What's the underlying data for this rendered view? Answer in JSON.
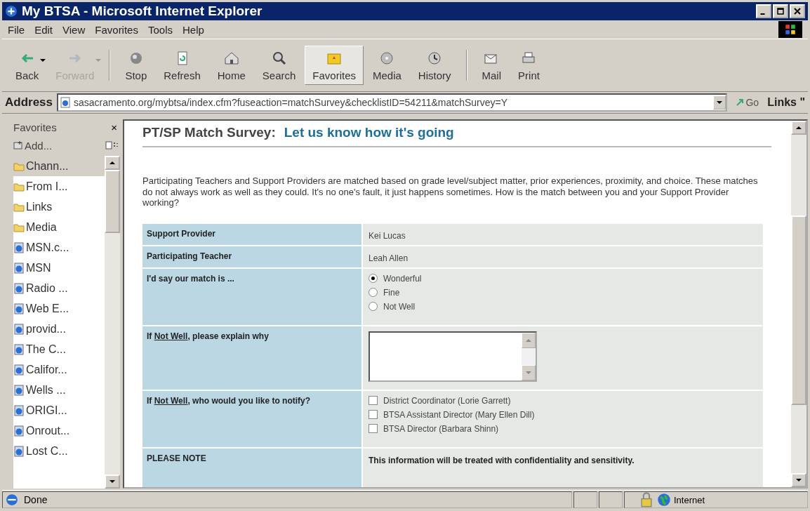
{
  "window": {
    "title": "My BTSA - Microsoft Internet Explorer"
  },
  "menu": [
    "File",
    "Edit",
    "View",
    "Favorites",
    "Tools",
    "Help"
  ],
  "toolbar": [
    {
      "label": "Back",
      "kind": "back",
      "disabled": false,
      "selected": false,
      "dropdown": true
    },
    {
      "label": "Forward",
      "kind": "forward",
      "disabled": true,
      "selected": false,
      "dropdown": true
    },
    {
      "label": "Stop",
      "kind": "stop",
      "disabled": false,
      "selected": false,
      "dropdown": false
    },
    {
      "label": "Refresh",
      "kind": "refresh",
      "disabled": false,
      "selected": false,
      "dropdown": false
    },
    {
      "label": "Home",
      "kind": "home",
      "disabled": false,
      "selected": false,
      "dropdown": false
    },
    {
      "label": "Search",
      "kind": "search",
      "disabled": false,
      "selected": false,
      "dropdown": false
    },
    {
      "label": "Favorites",
      "kind": "favorites",
      "disabled": false,
      "selected": true,
      "dropdown": false
    },
    {
      "label": "Media",
      "kind": "media",
      "disabled": false,
      "selected": false,
      "dropdown": false
    },
    {
      "label": "History",
      "kind": "history",
      "disabled": false,
      "selected": false,
      "dropdown": false
    },
    {
      "label": "Mail",
      "kind": "mail",
      "disabled": false,
      "selected": false,
      "dropdown": false
    },
    {
      "label": "Print",
      "kind": "print",
      "disabled": false,
      "selected": false,
      "dropdown": false
    }
  ],
  "address": {
    "label": "Address",
    "value": "sasacramento.org/mybtsa/index.cfm?fuseaction=matchSurvey&checklistID=54211&matchSurvey=Y",
    "go": "Go",
    "links": "Links \""
  },
  "favorites": {
    "title": "Favorites",
    "close": "×",
    "add": "Add...",
    "items": [
      {
        "label": "Chann...",
        "kind": "folder",
        "selected": true
      },
      {
        "label": "From I...",
        "kind": "folder",
        "selected": false
      },
      {
        "label": "Links",
        "kind": "folder",
        "selected": false
      },
      {
        "label": "Media",
        "kind": "folder",
        "selected": false
      },
      {
        "label": "MSN.c...",
        "kind": "link",
        "selected": false
      },
      {
        "label": "MSN",
        "kind": "link",
        "selected": false
      },
      {
        "label": "Radio ...",
        "kind": "link",
        "selected": false
      },
      {
        "label": "Web E...",
        "kind": "link",
        "selected": false
      },
      {
        "label": "provid...",
        "kind": "link",
        "selected": false
      },
      {
        "label": "The C...",
        "kind": "link",
        "selected": false
      },
      {
        "label": "Califor...",
        "kind": "link",
        "selected": false
      },
      {
        "label": "Wells ...",
        "kind": "link",
        "selected": false
      },
      {
        "label": "ORIGI...",
        "kind": "link",
        "selected": false
      },
      {
        "label": "Onrout...",
        "kind": "link",
        "selected": false
      },
      {
        "label": "Lost C...",
        "kind": "link",
        "selected": false
      }
    ]
  },
  "page": {
    "heading": "PT/SP Match Survey:",
    "subheading": "Let us know how it's going",
    "intro": "Participating Teachers and Support Providers are matched based on grade level/subject matter, prior experiences, proximity, and choice. These matches do not always work as well as they could. It's no one's fault, it just happens sometimes. How is the match between you and your Support Provider working?",
    "rows": [
      {
        "kind": "text",
        "label": [
          {
            "text": "Support Provider",
            "underline": false
          }
        ],
        "value": "Kei Lucas"
      },
      {
        "kind": "text",
        "label": [
          {
            "text": "Participating Teacher",
            "underline": false
          }
        ],
        "value": "Leah Allen"
      },
      {
        "kind": "radio",
        "label": [
          {
            "text": "I'd say our match is ...",
            "underline": false
          }
        ],
        "options": [
          {
            "label": "Wonderful",
            "selected": true
          },
          {
            "label": "Fine",
            "selected": false
          },
          {
            "label": "Not Well",
            "selected": false
          }
        ]
      },
      {
        "kind": "textarea",
        "label": [
          {
            "text": "If ",
            "underline": false
          },
          {
            "text": "Not Well",
            "underline": true
          },
          {
            "text": ", please explain why",
            "underline": false
          }
        ]
      },
      {
        "kind": "checkbox",
        "label": [
          {
            "text": "If ",
            "underline": false
          },
          {
            "text": "Not Well",
            "underline": true
          },
          {
            "text": ", who would you like to notify?",
            "underline": false
          }
        ],
        "options": [
          {
            "label": "District Coordinator (Lorie Garrett)",
            "checked": false
          },
          {
            "label": "BTSA Assistant Director (Mary Ellen Dill)",
            "checked": false
          },
          {
            "label": "BTSA Director (Barbara Shinn)",
            "checked": false
          }
        ]
      },
      {
        "kind": "note",
        "label": [
          {
            "text": "PLEASE NOTE",
            "underline": false
          }
        ],
        "value": "This information will be treated with confidentiality and sensitivity."
      }
    ]
  },
  "status_bar": {
    "text": "Done",
    "zone": "Internet"
  }
}
